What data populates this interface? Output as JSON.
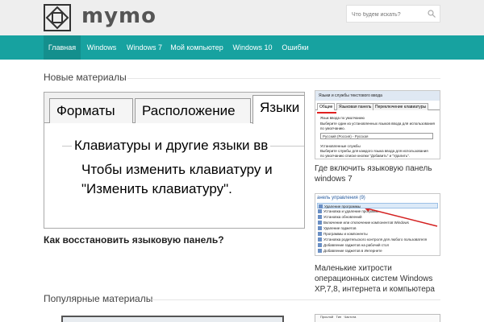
{
  "header": {
    "logo_text": "mymo",
    "search_placeholder": "Что будем искать?"
  },
  "nav": {
    "items": [
      {
        "label": "Главная"
      },
      {
        "label": "Windows"
      },
      {
        "label": "Windows 7"
      },
      {
        "label": "Мой компьютер"
      },
      {
        "label": "Windows 10"
      },
      {
        "label": "Ошибки"
      }
    ],
    "active_index": 0
  },
  "sections": {
    "new_title": "Новые материалы",
    "popular_title": "Популярные материалы"
  },
  "feature": {
    "tabs": [
      "Форматы",
      "Расположение",
      "Языки"
    ],
    "group_label": "Клавиатуры и другие языки вв",
    "line1": "Чтобы изменить клавиатуру и",
    "line2": "\"Изменить клавиатуру\".",
    "title": "Как восстановить языковую панель?"
  },
  "side_articles": [
    {
      "caption": "Где включить языковую панель windows 7",
      "thumb": {
        "window_title": "Языки и службы текстового ввода",
        "tabs": [
          "Общие",
          "Языковая панель",
          "Переключение клавиатуры"
        ],
        "section1": "Язык ввода по умолчанию",
        "text1": "Выберите один из установленных языков ввода для использования",
        "text1b": "по умолчанию.",
        "select_value": "Русский (Россия) - Русская",
        "section2": "Установленные службы",
        "text2": "Выберите службы для каждого языка ввода для использования",
        "text2b": "по умолчанию списке кнопки \"Добавить\" и \"Удалить\"."
      }
    },
    {
      "caption": "Маленькие хитрости операционных систем Windows XP,7,8, интернета и компьютера",
      "thumb": {
        "header": "анель управления (9)",
        "rows": [
          "Удаление программы",
          "Установка и удаление программ",
          "Установка обновлений",
          "Включение или отключение компонентов Windows",
          "Удаление гаджетов",
          "Программы и компоненты",
          "Установка родительского контроля для любого пользователя",
          "Добавление гаджетов на рабочий стол",
          "Добавление гаджетов в Интернете"
        ],
        "highlight_index": 0
      }
    }
  ],
  "bottom_thumb": {
    "cells": [
      "Прослой",
      "Тип",
      "Частота"
    ]
  }
}
